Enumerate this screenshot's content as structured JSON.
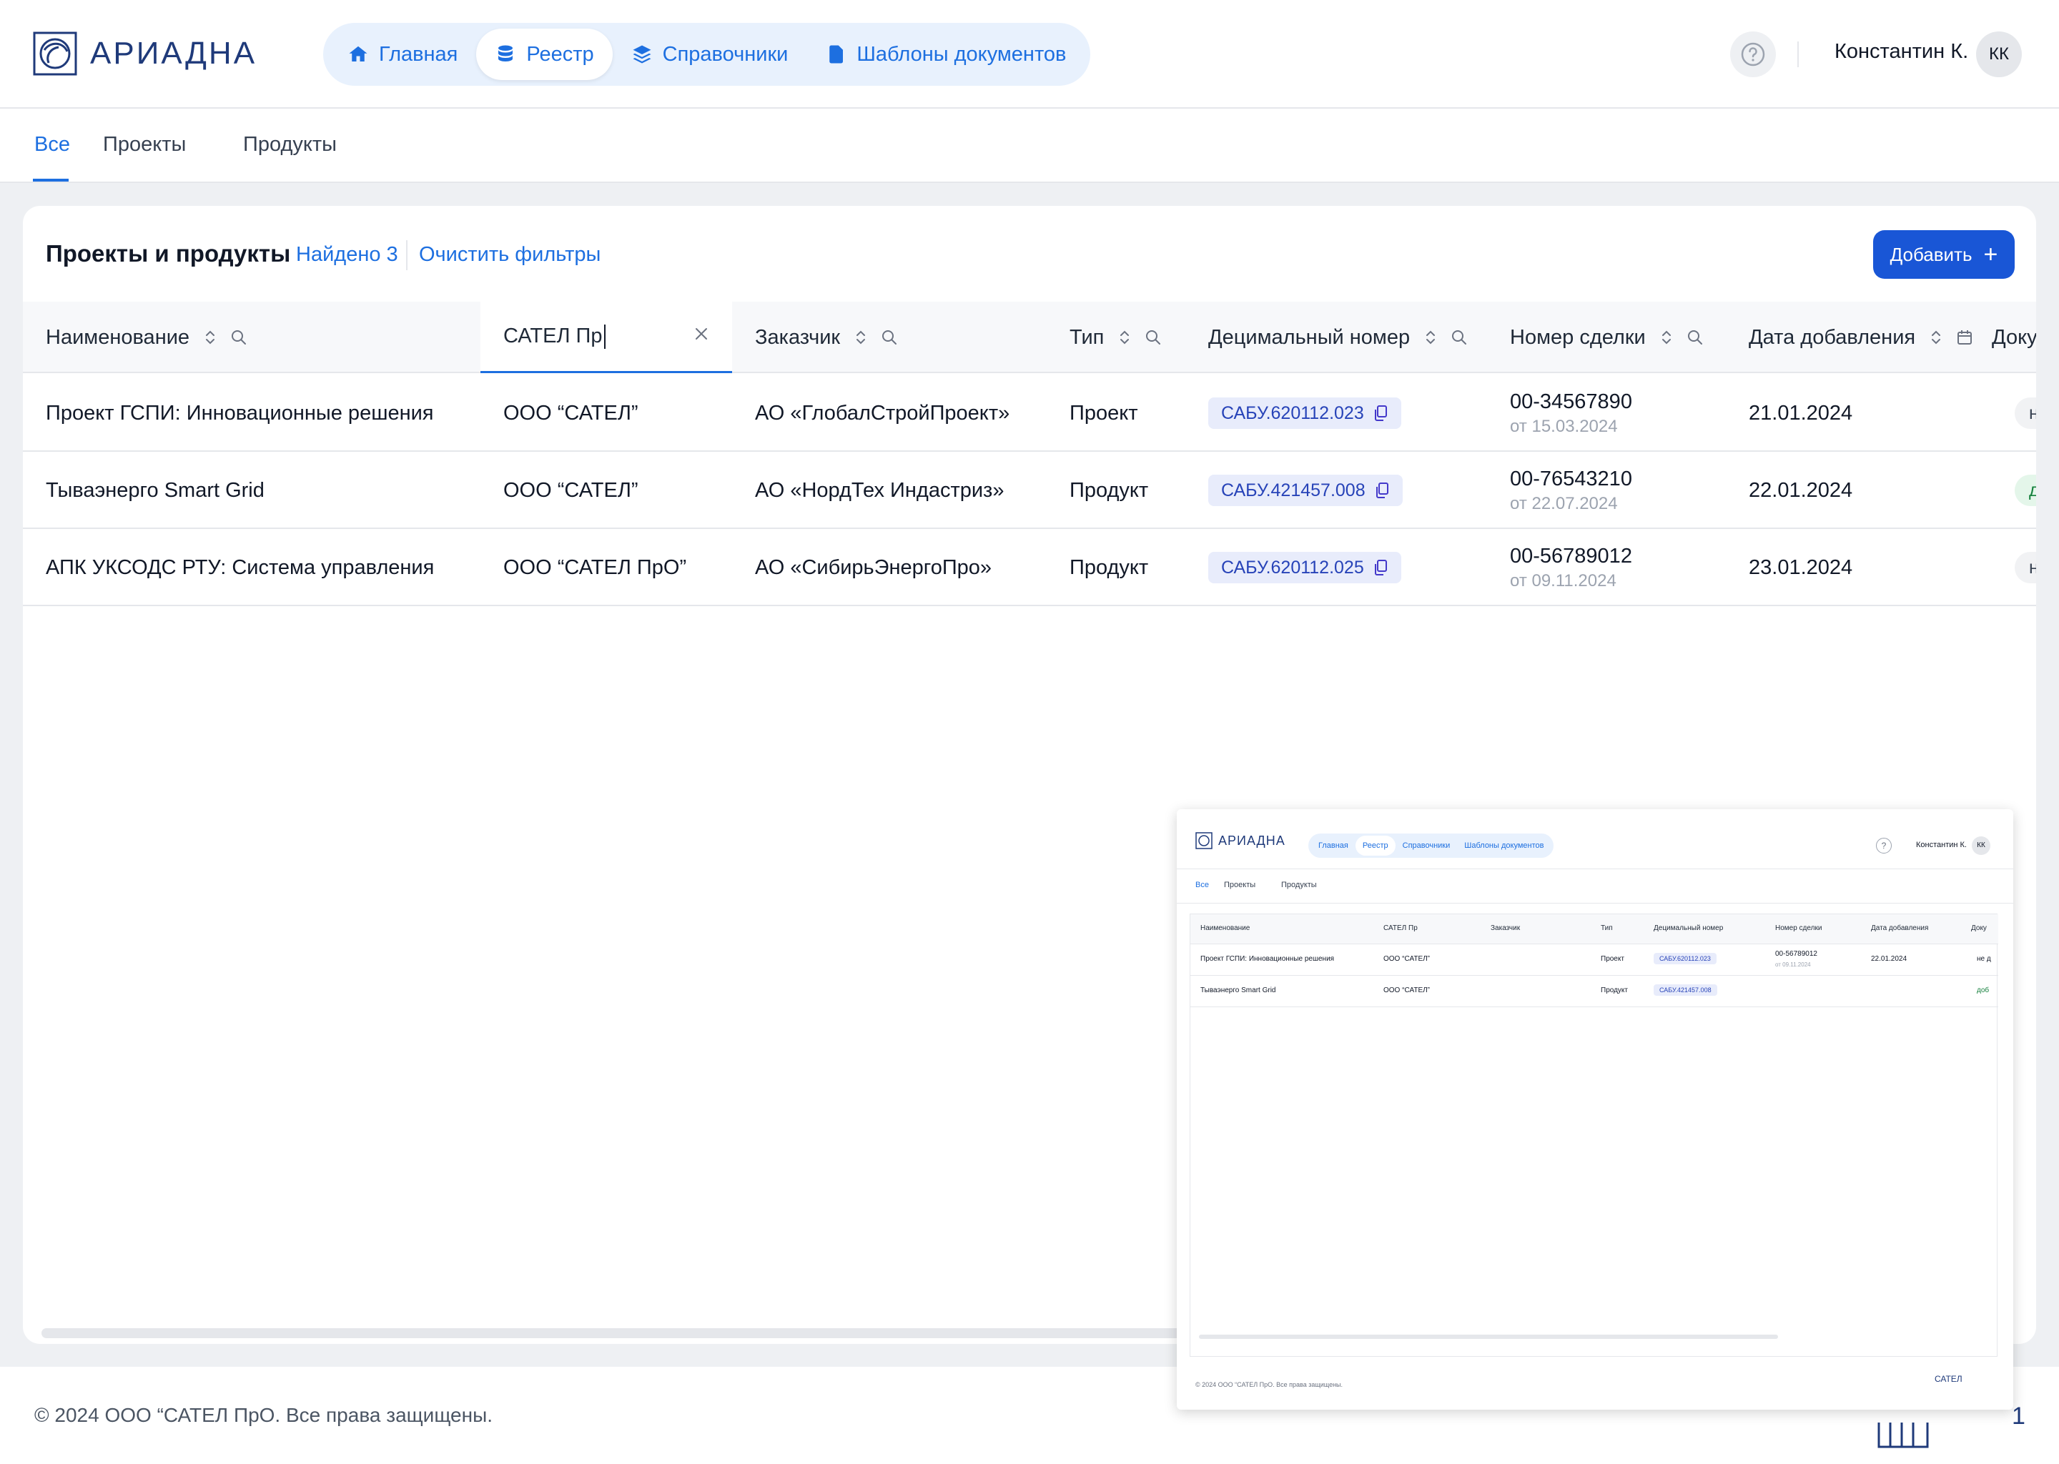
{
  "app": {
    "name": "АРИАДНА"
  },
  "nav": {
    "items": [
      {
        "label": "Главная",
        "icon": "home-icon",
        "active": false
      },
      {
        "label": "Реестр",
        "icon": "database-icon",
        "active": true
      },
      {
        "label": "Справочники",
        "icon": "layers-icon",
        "active": false
      },
      {
        "label": "Шаблоны документов",
        "icon": "document-icon",
        "active": false
      }
    ]
  },
  "user": {
    "name": "Константин К.",
    "initials": "КК"
  },
  "tabs": [
    {
      "label": "Все",
      "active": true
    },
    {
      "label": "Проекты",
      "active": false
    },
    {
      "label": "Продукты",
      "active": false
    }
  ],
  "card": {
    "title": "Проекты и продукты",
    "found": "Найдено 3",
    "clear_filters": "Очистить фильтры",
    "add_label": "Добавить"
  },
  "table": {
    "columns": [
      "Наименование",
      "САТЕЛ Пр",
      "Заказчик",
      "Тип",
      "Децимальный номер",
      "Номер сделки",
      "Дата добавления",
      "Доку"
    ],
    "filter_value": "САТЕЛ Пр",
    "rows": [
      {
        "name": "Проект ГСПИ: Инновационные решения",
        "org": "ООО “САТЕЛ”",
        "customer": "АО «ГлобалСтройПроект»",
        "type": "Проект",
        "decimal": "САБУ.620112.023",
        "deal": "00-34567890",
        "deal_date": "от 15.03.2024",
        "added": "21.01.2024",
        "status": "не д",
        "status_kind": "gray"
      },
      {
        "name": "Тываэнерго Smart Grid",
        "org": "ООО “САТЕЛ”",
        "customer": "АО «НордТех Индастриз»",
        "type": "Продукт",
        "decimal": "САБУ.421457.008",
        "deal": "00-76543210",
        "deal_date": "от 22.07.2024",
        "added": "22.01.2024",
        "status": "доб",
        "status_kind": "green"
      },
      {
        "name": "АПК УКСОДС РТУ: Система управления",
        "org": "ООО “САТЕЛ ПрО”",
        "customer": "АО «СибирьЭнергоПро»",
        "type": "Продукт",
        "decimal": "САБУ.620112.025",
        "deal": "00-56789012",
        "deal_date": "от 09.11.2024",
        "added": "23.01.2024",
        "status": "не д",
        "status_kind": "gray"
      }
    ]
  },
  "footer": {
    "copyright": "© 2024 ООО “САТЕЛ ПрО. Все права защищены.",
    "page": "1"
  },
  "thumbnail": {
    "app_name": "АРИАДНА",
    "nav": [
      "Главная",
      "Реестр",
      "Справочники",
      "Шаблоны документов"
    ],
    "user": "Константин К.",
    "initials": "КК",
    "tabs": [
      "Все",
      "Проекты",
      "Продукты"
    ],
    "columns": [
      "Наименование",
      "САТЕЛ Пр",
      "Заказчик",
      "Тип",
      "Децимальный номер",
      "Номер сделки",
      "Дата добавления",
      "Доку"
    ],
    "rows": [
      {
        "name": "Проект ГСПИ: Инновационные решения",
        "org": "ООО “САТЕЛ”",
        "type": "Проект",
        "decimal": "САБУ.620112.023",
        "deal": "00-56789012",
        "deal_date": "от 09.11.2024",
        "added": "22.01.2024",
        "status": "не д"
      },
      {
        "name": "Тываэнерго Smart Grid",
        "org": "ООО “САТЕЛ”",
        "type": "Продукт",
        "decimal": "САБУ.421457.008",
        "status": "доб"
      }
    ],
    "footer": "© 2024 ООО “САТЕЛ ПрО. Все права защищены.",
    "brand": "САТЕЛ"
  },
  "colors": {
    "accent": "#1d6fe0",
    "button": "#1956d6",
    "chip_bg": "#e8ecfb",
    "brand": "#1f3a7a"
  }
}
